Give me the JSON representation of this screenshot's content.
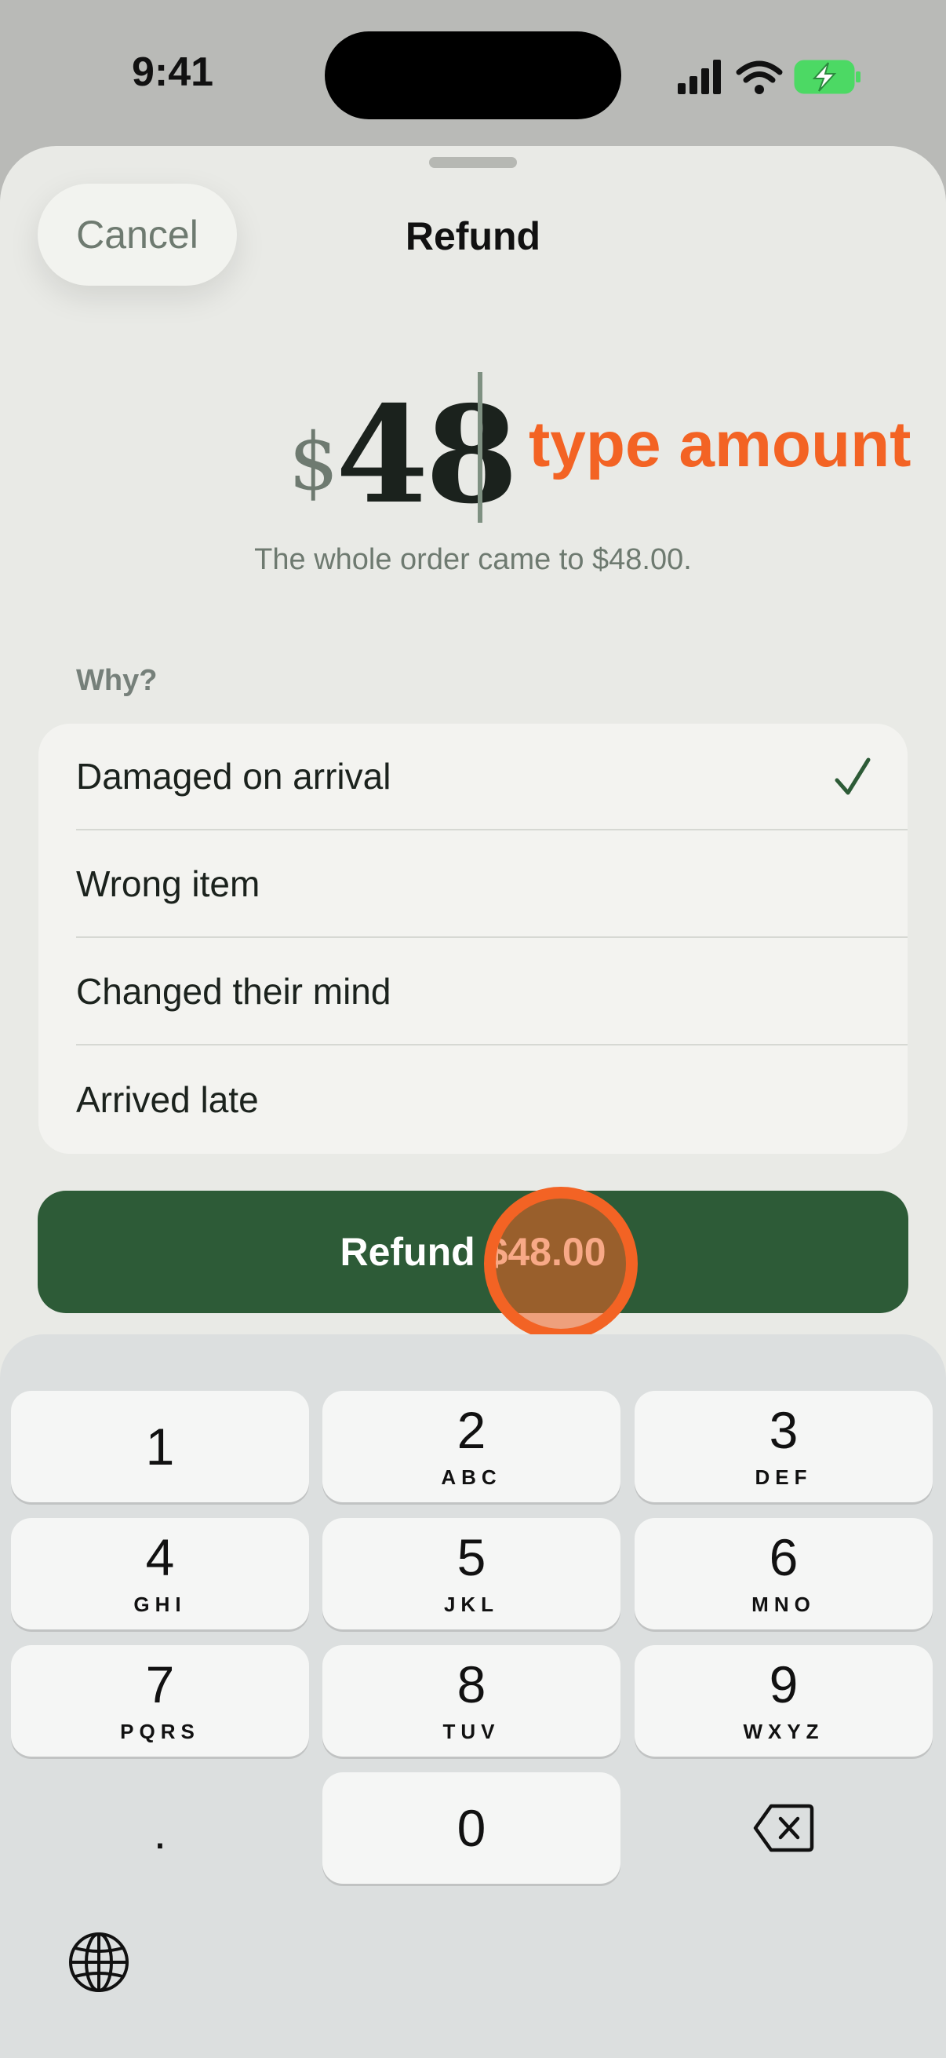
{
  "status_bar": {
    "time": "9:41"
  },
  "sheet": {
    "cancel_label": "Cancel",
    "title": "Refund"
  },
  "amount": {
    "currency": "$",
    "value": "48",
    "annotation": "type amount",
    "order_note": "The whole order came to $48.00."
  },
  "reasons": {
    "heading": "Why?",
    "items": [
      {
        "label": "Damaged on arrival",
        "selected": true
      },
      {
        "label": "Wrong item",
        "selected": false
      },
      {
        "label": "Changed their mind",
        "selected": false
      },
      {
        "label": "Arrived late",
        "selected": false
      }
    ]
  },
  "refund_button": {
    "label": "Refund $48.00"
  },
  "keypad": {
    "keys": [
      {
        "digit": "1",
        "letters": ""
      },
      {
        "digit": "2",
        "letters": "ABC"
      },
      {
        "digit": "3",
        "letters": "DEF"
      },
      {
        "digit": "4",
        "letters": "GHI"
      },
      {
        "digit": "5",
        "letters": "JKL"
      },
      {
        "digit": "6",
        "letters": "MNO"
      },
      {
        "digit": "7",
        "letters": "PQRS"
      },
      {
        "digit": "8",
        "letters": "TUV"
      },
      {
        "digit": "9",
        "letters": "WXYZ"
      },
      {
        "digit": "0",
        "letters": ""
      }
    ],
    "decimal_label": "."
  },
  "icons": {
    "signal": "cellular-signal-icon",
    "wifi": "wifi-icon",
    "battery": "battery-charging-icon",
    "check": "checkmark-icon",
    "delete": "delete-backspace-icon",
    "globe": "globe-icon"
  },
  "colors": {
    "accent_green": "#2d5b37",
    "annotation_orange": "#f36324",
    "battery_green": "#4cd964"
  }
}
